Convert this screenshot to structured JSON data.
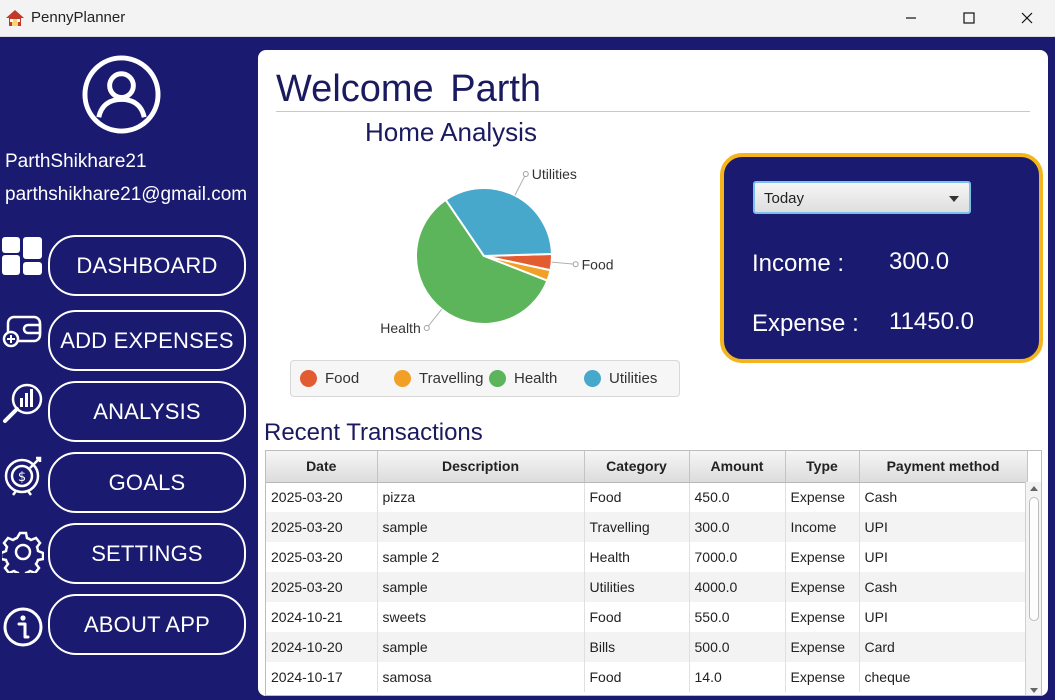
{
  "window": {
    "title": "PennyPlanner"
  },
  "user": {
    "name": "ParthShikhare21",
    "email": "parthshikhare21@gmail.com"
  },
  "nav": [
    {
      "label": "DASHBOARD",
      "icon": "dashboard-icon"
    },
    {
      "label": "ADD EXPENSES",
      "icon": "wallet-icon"
    },
    {
      "label": "ANALYSIS",
      "icon": "analysis-icon"
    },
    {
      "label": "GOALS",
      "icon": "target-icon"
    },
    {
      "label": "SETTINGS",
      "icon": "gear-icon"
    },
    {
      "label": "ABOUT APP",
      "icon": "info-icon"
    }
  ],
  "main": {
    "welcome": "Welcome Parth",
    "summary": {
      "period": "Today",
      "income_label": "Income :",
      "income_value": "300.0",
      "expense_label": "Expense :",
      "expense_value": "11450.0"
    },
    "transactions_title": "Recent Transactions",
    "table": {
      "columns": [
        "Date",
        "Description",
        "Category",
        "Amount",
        "Type",
        "Payment method"
      ],
      "rows": [
        [
          "2025-03-20",
          "pizza",
          "Food",
          "450.0",
          "Expense",
          "Cash"
        ],
        [
          "2025-03-20",
          "sample",
          "Travelling",
          "300.0",
          "Income",
          "UPI"
        ],
        [
          "2025-03-20",
          "sample 2",
          "Health",
          "7000.0",
          "Expense",
          "UPI"
        ],
        [
          "2025-03-20",
          "sample",
          "Utilities",
          "4000.0",
          "Expense",
          "Cash"
        ],
        [
          "2024-10-21",
          "sweets",
          "Food",
          "550.0",
          "Expense",
          "UPI"
        ],
        [
          "2024-10-20",
          "sample",
          "Bills",
          "500.0",
          "Expense",
          "Card"
        ],
        [
          "2024-10-17",
          "samosa",
          "Food",
          "14.0",
          "Expense",
          "cheque"
        ]
      ]
    }
  },
  "chart_data": {
    "type": "pie",
    "title": "Home Analysis",
    "categories": [
      "Food",
      "Travelling",
      "Health",
      "Utilities"
    ],
    "values": [
      450,
      300,
      7000,
      4000
    ],
    "colors": [
      "#e35b30",
      "#f1a025",
      "#5cb55a",
      "#48a8cb"
    ],
    "slice_labels": [
      "Food",
      "",
      "Health",
      "Utilities"
    ],
    "legend_position": "bottom"
  },
  "colors": {
    "background": "#1a1a70",
    "accent_border": "#f3b51b",
    "title_text": "#1a1a5e"
  }
}
